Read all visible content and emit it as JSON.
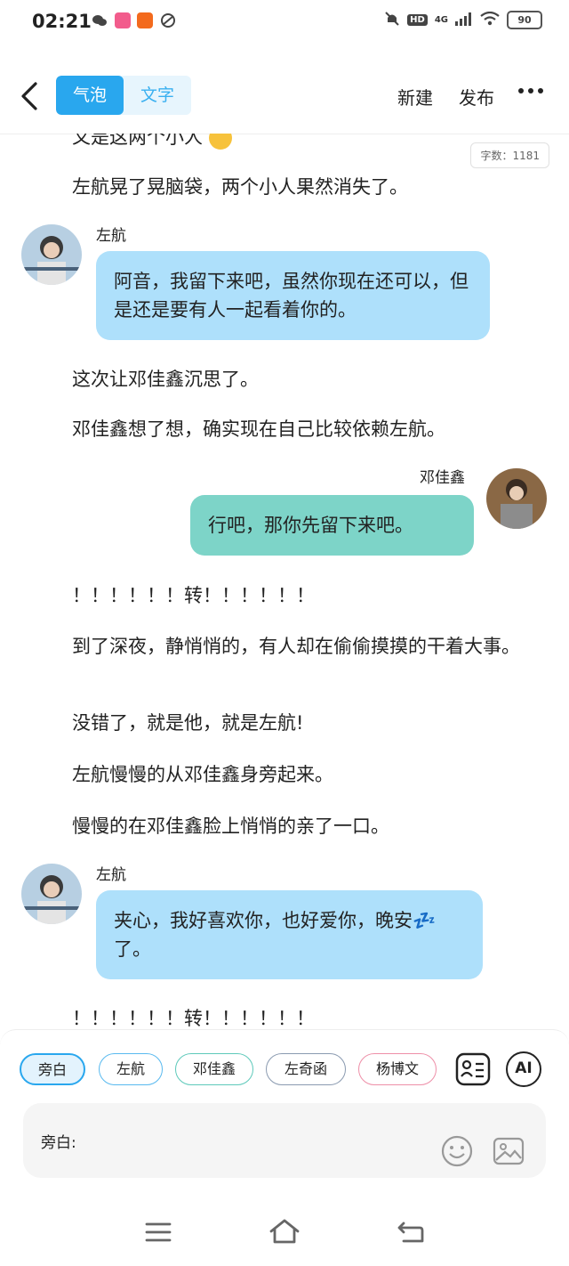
{
  "status": {
    "time": "02:21",
    "battery": "90",
    "network": "4G",
    "hd": "HD"
  },
  "header": {
    "mode_bubble": "气泡",
    "mode_text": "文字",
    "new_label": "新建",
    "publish_label": "发布"
  },
  "word_count": "字数：1181",
  "story": {
    "partial_line": "又是这两个小人",
    "narration_1": "左航晃了晃脑袋，两个小人果然消失了。",
    "msg1_name": "左航",
    "msg1_text": "阿音，我留下来吧，虽然你现在还可以，但是还是要有人一起看着你的。",
    "narration_2": "这次让邓佳鑫沉思了。",
    "narration_3": "邓佳鑫想了想，确实现在自己比较依赖左航。",
    "msg2_name": "邓佳鑫",
    "msg2_text": "行吧，那你先留下来吧。",
    "narration_4": "！！！！！！转！！！！！！",
    "narration_5": "到了深夜，静悄悄的，有人却在偷偷摸摸的干着大事。",
    "narration_6": "没错了，就是他，就是左航!",
    "narration_7": "左航慢慢的从邓佳鑫身旁起来。",
    "narration_8": "慢慢的在邓佳鑫脸上悄悄的亲了一口。",
    "msg3_name": "左航",
    "msg3_text": "夹心，我好喜欢你，也好爱你，晚安💤了。",
    "narration_9": "！！！！！！转！！！！！！"
  },
  "roles": [
    "旁白",
    "左航",
    "邓佳鑫",
    "左奇函",
    "杨博文"
  ],
  "ai_label": "AI",
  "input_label": "旁白:",
  "colors": {
    "accent": "#29a7ee",
    "bubble_blue": "#aee0fb",
    "bubble_green": "#7dd4c8"
  }
}
